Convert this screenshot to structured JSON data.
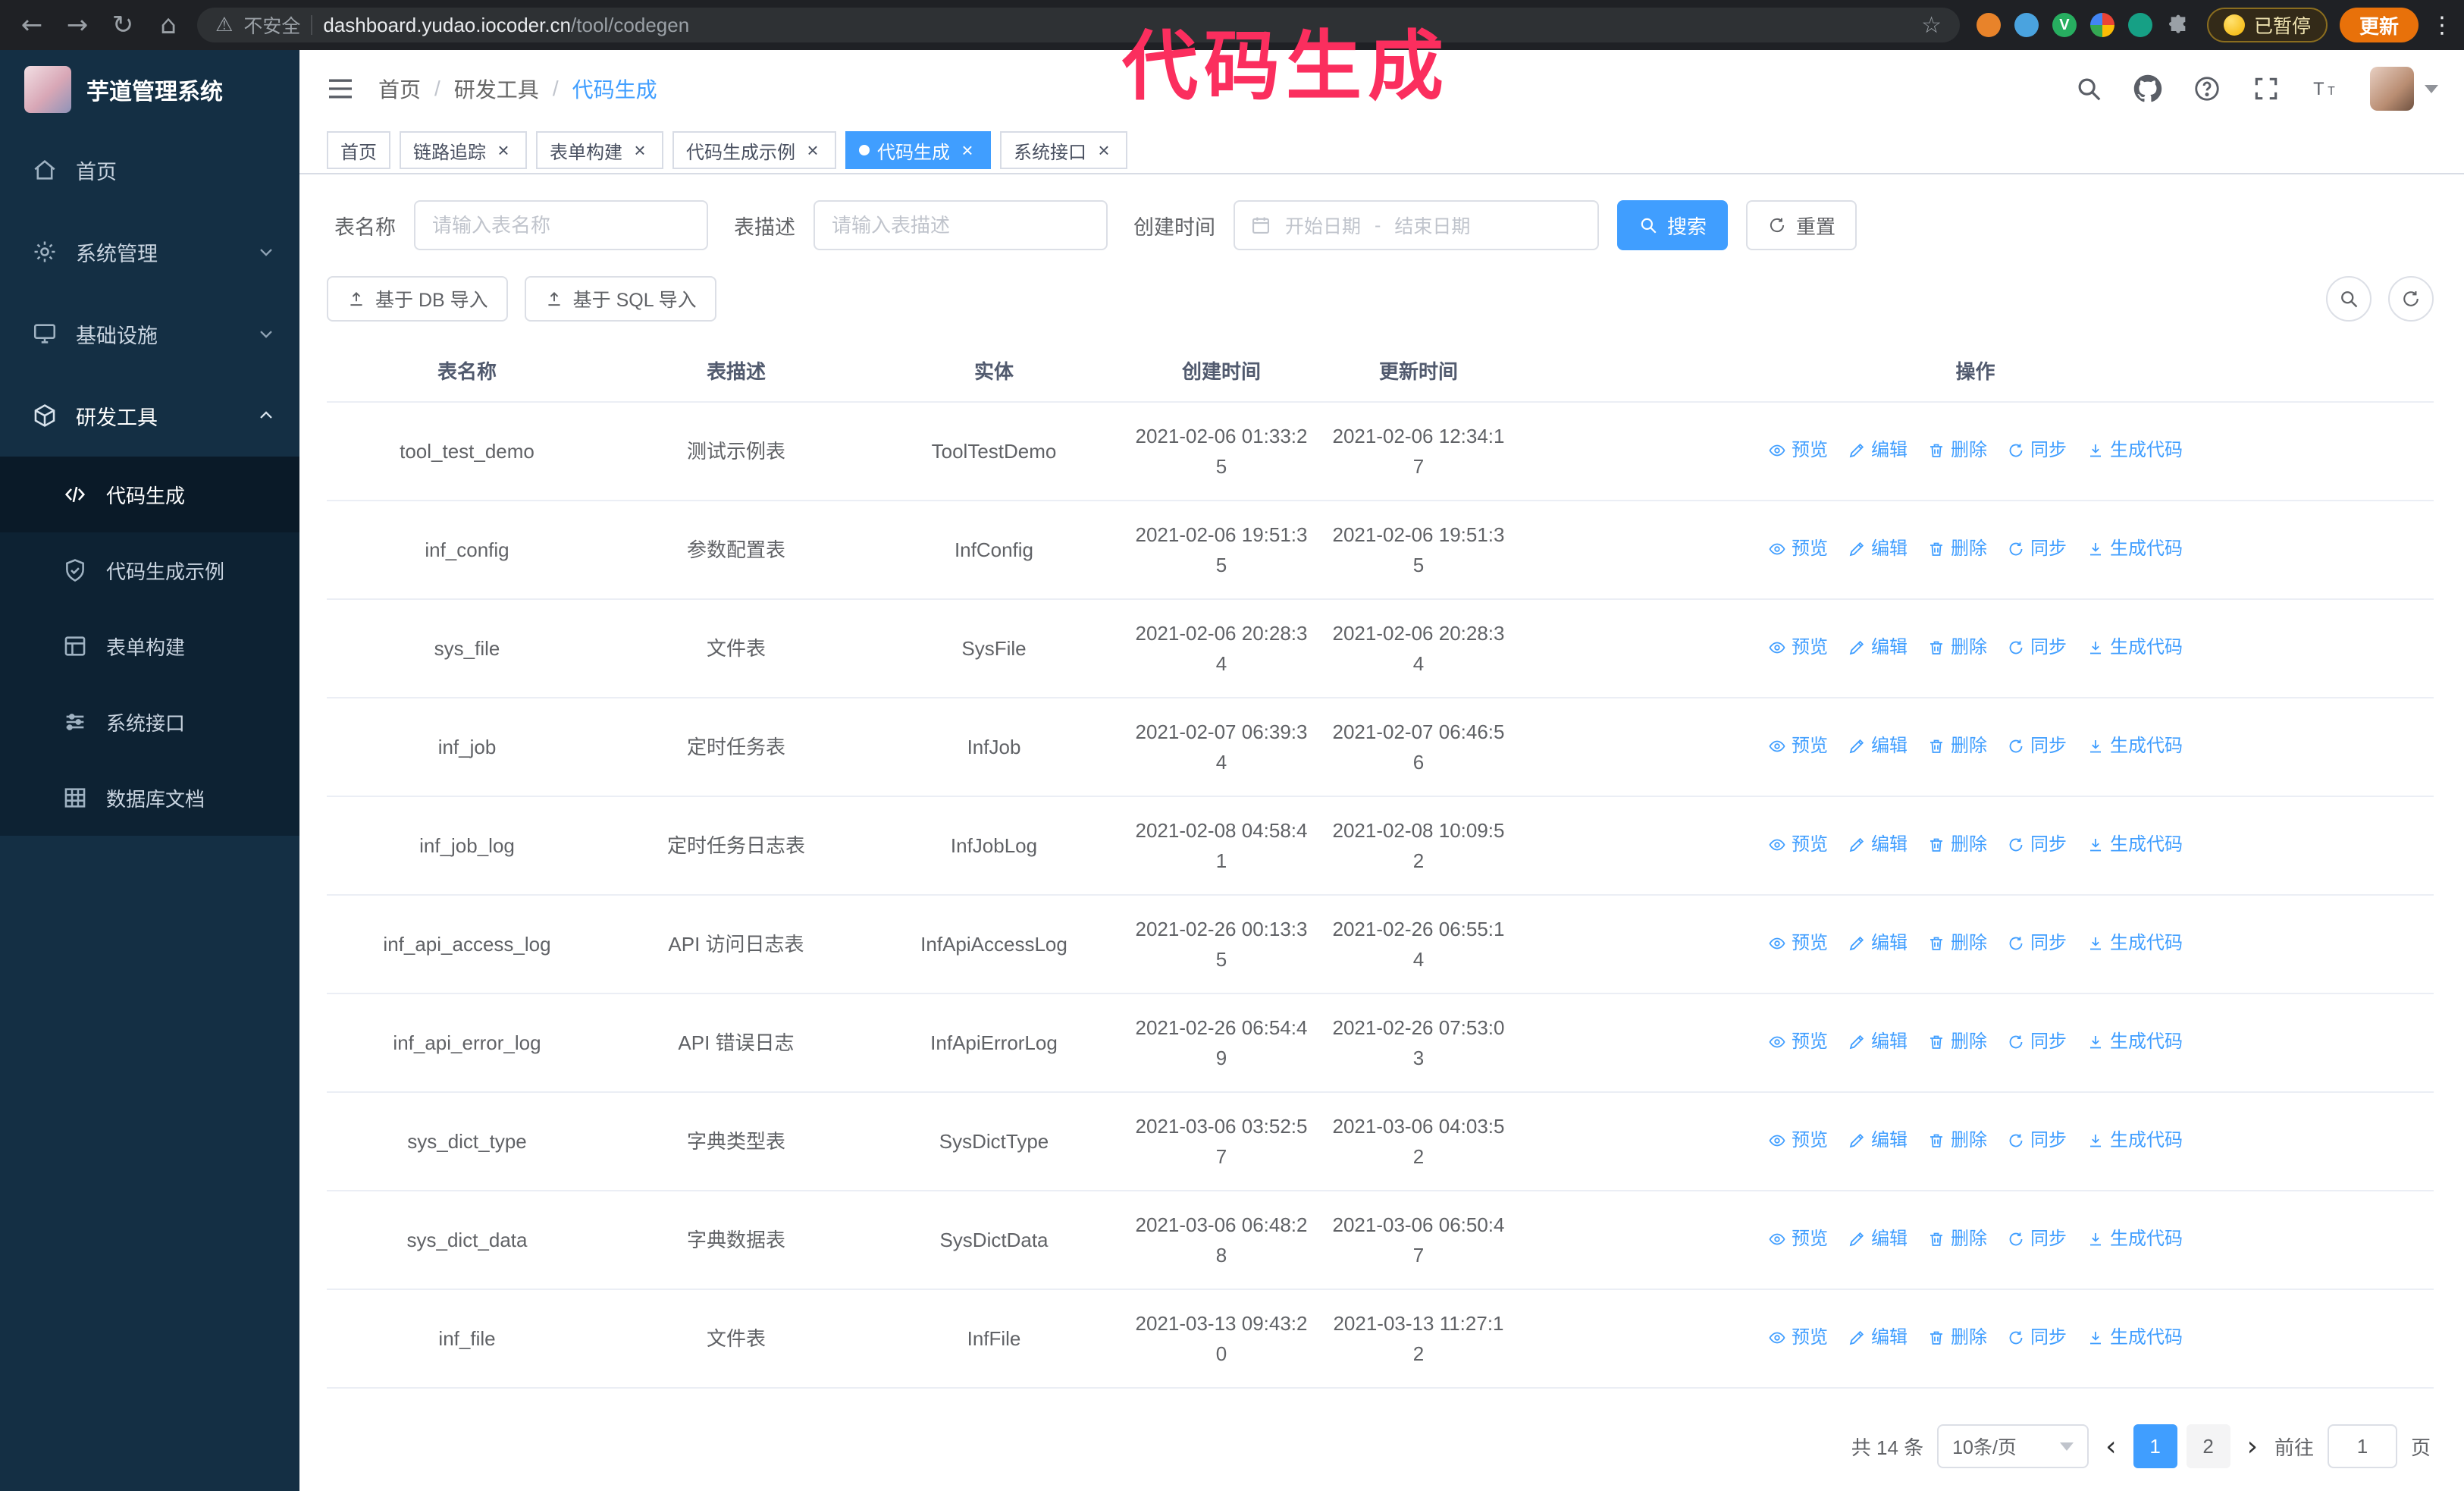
{
  "browser": {
    "security_label": "不安全",
    "url_host": "dashboard.yudao.iocoder.cn",
    "url_path": "/tool/codegen",
    "paused_badge": "已暂停",
    "update_button": "更新"
  },
  "annotation": {
    "text": "代码生成",
    "color": "#fb2e5e"
  },
  "sidebar": {
    "logo_title": "芋道管理系统",
    "items": [
      {
        "id": "home",
        "label": "首页",
        "icon": "home-icon"
      },
      {
        "id": "system",
        "label": "系统管理",
        "icon": "gear-icon",
        "chevron": "down"
      },
      {
        "id": "infra",
        "label": "基础设施",
        "icon": "monitor-icon",
        "chevron": "down"
      },
      {
        "id": "devtools",
        "label": "研发工具",
        "icon": "cube-icon",
        "chevron": "up",
        "expanded": true,
        "children": [
          {
            "id": "codegen",
            "label": "代码生成",
            "icon": "code-icon",
            "active": true
          },
          {
            "id": "codegen-demo",
            "label": "代码生成示例",
            "icon": "shield-icon"
          },
          {
            "id": "form-build",
            "label": "表单构建",
            "icon": "form-icon"
          },
          {
            "id": "system-api",
            "label": "系统接口",
            "icon": "sliders-icon"
          },
          {
            "id": "db-doc",
            "label": "数据库文档",
            "icon": "grid-icon"
          }
        ]
      }
    ]
  },
  "breadcrumb": [
    "首页",
    "研发工具",
    "代码生成"
  ],
  "tabs": [
    {
      "label": "首页",
      "closable": false,
      "active": false
    },
    {
      "label": "链路追踪",
      "closable": true,
      "active": false
    },
    {
      "label": "表单构建",
      "closable": true,
      "active": false
    },
    {
      "label": "代码生成示例",
      "closable": true,
      "active": false
    },
    {
      "label": "代码生成",
      "closable": true,
      "active": true
    },
    {
      "label": "系统接口",
      "closable": true,
      "active": false
    }
  ],
  "filters": {
    "table_name_label": "表名称",
    "table_name_placeholder": "请输入表名称",
    "table_desc_label": "表描述",
    "table_desc_placeholder": "请输入表描述",
    "create_time_label": "创建时间",
    "date_start_placeholder": "开始日期",
    "date_separator": "-",
    "date_end_placeholder": "结束日期",
    "search_button": "搜索",
    "reset_button": "重置"
  },
  "toolbar": {
    "import_db_button": "基于 DB 导入",
    "import_sql_button": "基于 SQL 导入"
  },
  "table": {
    "columns": [
      "表名称",
      "表描述",
      "实体",
      "创建时间",
      "更新时间",
      "操作"
    ],
    "rows": [
      {
        "name": "tool_test_demo",
        "desc": "测试示例表",
        "entity": "ToolTestDemo",
        "created": "2021-02-06 01:33:25",
        "updated": "2021-02-06 12:34:17"
      },
      {
        "name": "inf_config",
        "desc": "参数配置表",
        "entity": "InfConfig",
        "created": "2021-02-06 19:51:35",
        "updated": "2021-02-06 19:51:35"
      },
      {
        "name": "sys_file",
        "desc": "文件表",
        "entity": "SysFile",
        "created": "2021-02-06 20:28:34",
        "updated": "2021-02-06 20:28:34"
      },
      {
        "name": "inf_job",
        "desc": "定时任务表",
        "entity": "InfJob",
        "created": "2021-02-07 06:39:34",
        "updated": "2021-02-07 06:46:56"
      },
      {
        "name": "inf_job_log",
        "desc": "定时任务日志表",
        "entity": "InfJobLog",
        "created": "2021-02-08 04:58:41",
        "updated": "2021-02-08 10:09:52"
      },
      {
        "name": "inf_api_access_log",
        "desc": "API 访问日志表",
        "entity": "InfApiAccessLog",
        "created": "2021-02-26 00:13:35",
        "updated": "2021-02-26 06:55:14"
      },
      {
        "name": "inf_api_error_log",
        "desc": "API 错误日志",
        "entity": "InfApiErrorLog",
        "created": "2021-02-26 06:54:49",
        "updated": "2021-02-26 07:53:03"
      },
      {
        "name": "sys_dict_type",
        "desc": "字典类型表",
        "entity": "SysDictType",
        "created": "2021-03-06 03:52:57",
        "updated": "2021-03-06 04:03:52"
      },
      {
        "name": "sys_dict_data",
        "desc": "字典数据表",
        "entity": "SysDictData",
        "created": "2021-03-06 06:48:28",
        "updated": "2021-03-06 06:50:47"
      },
      {
        "name": "inf_file",
        "desc": "文件表",
        "entity": "InfFile",
        "created": "2021-03-13 09:43:20",
        "updated": "2021-03-13 11:27:12"
      }
    ],
    "actions": [
      {
        "name": "preview-link",
        "label": "预览",
        "icon": "eye-icon"
      },
      {
        "name": "edit-link",
        "label": "编辑",
        "icon": "edit-icon"
      },
      {
        "name": "delete-link",
        "label": "删除",
        "icon": "delete-icon"
      },
      {
        "name": "sync-link",
        "label": "同步",
        "icon": "sync-icon"
      },
      {
        "name": "generate-link",
        "label": "生成代码",
        "icon": "download-icon"
      }
    ]
  },
  "pagination": {
    "total_text": "共 14 条",
    "page_size": "10条/页",
    "pages": [
      "1",
      "2"
    ],
    "active_page": "1",
    "goto_label": "前往",
    "goto_value": "1",
    "goto_suffix": "页"
  },
  "colors": {
    "accent": "#409eff",
    "sidebar_bg": "#142f44",
    "submenu_bg": "#0d2233"
  }
}
